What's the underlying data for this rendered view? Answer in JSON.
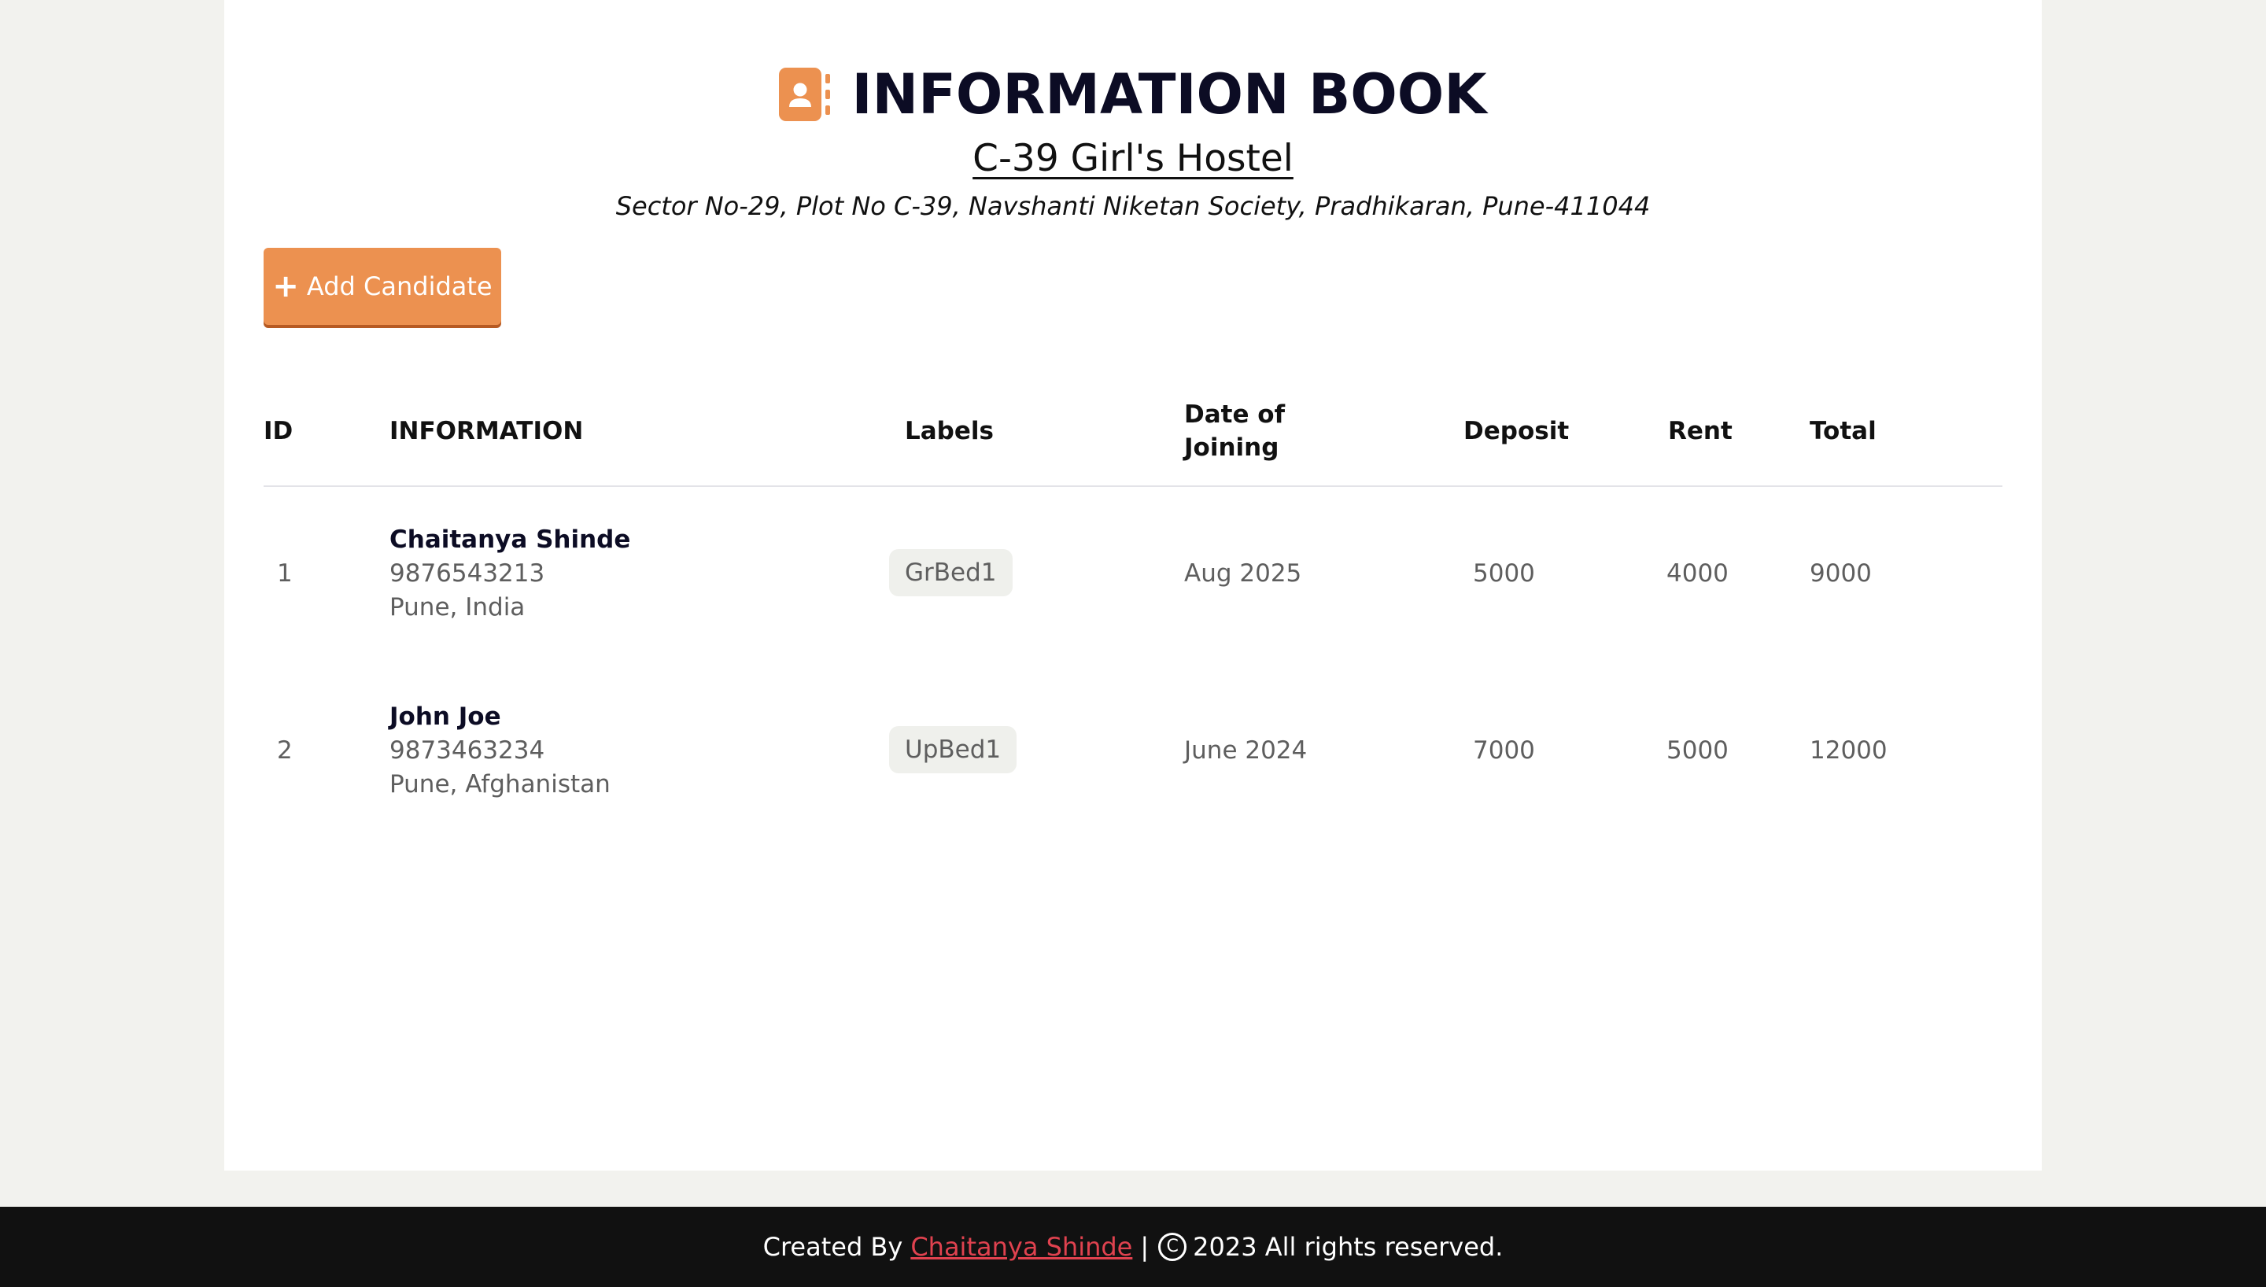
{
  "header": {
    "title": "INFORMATION BOOK",
    "hostel_name": "C-39 Girl's Hostel",
    "address": "Sector No-29, Plot No C-39, Navshanti Niketan Society, Pradhikaran, Pune-411044",
    "icon": "contact-book-icon"
  },
  "actions": {
    "add_label": "Add Candidate",
    "add_icon": "plus-icon"
  },
  "table": {
    "columns": {
      "id": "ID",
      "information": "INFORMATION",
      "labels": "Labels",
      "date_line1": "Date of",
      "date_line2": "Joining",
      "deposit": "Deposit",
      "rent": "Rent",
      "total": "Total"
    },
    "rows": [
      {
        "id": "1",
        "name": "Chaitanya Shinde",
        "phone": "9876543213",
        "location": "Pune, India",
        "label": "GrBed1",
        "date": "Aug 2025",
        "deposit": "5000",
        "rent": "4000",
        "total": "9000"
      },
      {
        "id": "2",
        "name": "John Joe",
        "phone": "9873463234",
        "location": "Pune, Afghanistan",
        "label": "UpBed1",
        "date": "June 2024",
        "deposit": "7000",
        "rent": "5000",
        "total": "12000"
      }
    ]
  },
  "footer": {
    "created_by": "Created By",
    "author": "Chaitanya Shinde",
    "separator": "|",
    "copyright_symbol": "C",
    "rights": "2023 All rights reserved."
  },
  "colors": {
    "accent": "#ec9150",
    "page_bg": "#f2f2ee",
    "footer_bg": "#111111",
    "link": "#e0424f"
  }
}
